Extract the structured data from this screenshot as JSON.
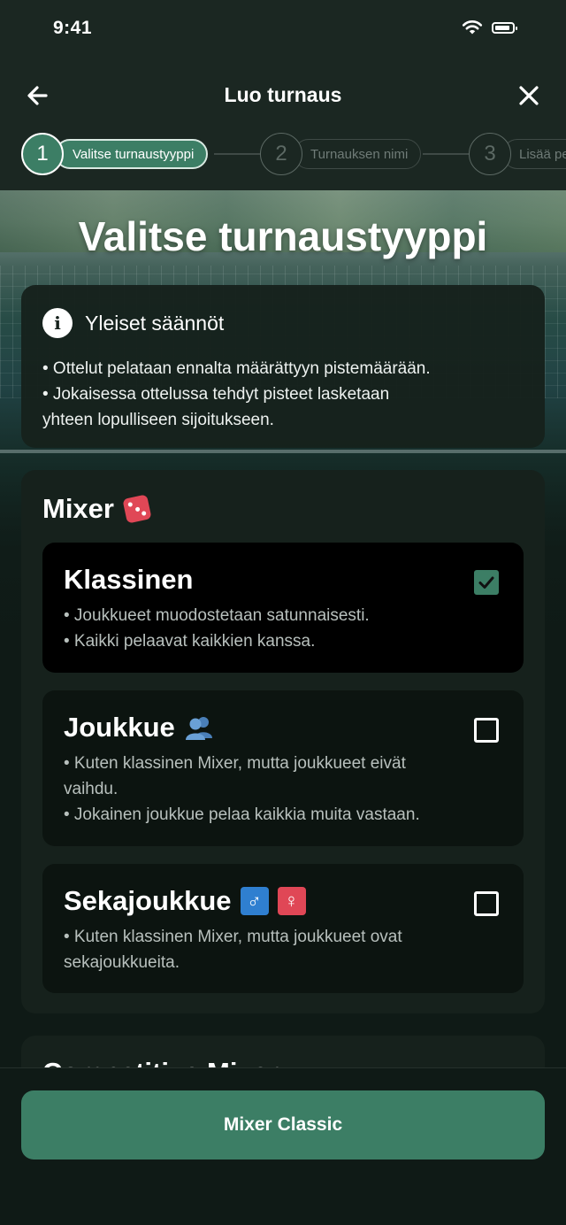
{
  "status_bar": {
    "time": "9:41"
  },
  "nav": {
    "title": "Luo turnaus"
  },
  "stepper": [
    {
      "number": "1",
      "label": "Valitse turnaustyyppi"
    },
    {
      "number": "2",
      "label": "Turnauksen nimi"
    },
    {
      "number": "3",
      "label": "Lisää pe"
    }
  ],
  "page": {
    "title": "Valitse turnaustyyppi"
  },
  "info": {
    "title": "Yleiset säännöt",
    "lines": [
      "• Ottelut pelataan ennalta määrättyyn pistemäärään.",
      "• Jokaisessa ottelussa tehdyt pisteet lasketaan",
      "yhteen lopulliseen sijoitukseen."
    ]
  },
  "mixer": {
    "title": "Mixer",
    "options": [
      {
        "title": "Klassinen",
        "lines": [
          "• Joukkueet muodostetaan satunnaisesti.",
          "• Kaikki pelaavat kaikkien kanssa."
        ],
        "checked": true
      },
      {
        "title": "Joukkue",
        "lines": [
          "• Kuten klassinen Mixer, mutta joukkueet eivät",
          "vaihdu.",
          "• Jokainen joukkue pelaa kaikkia muita vastaan."
        ],
        "checked": false
      },
      {
        "title": "Sekajoukkue",
        "male_symbol": "♂",
        "female_symbol": "♀",
        "lines": [
          "• Kuten klassinen Mixer, mutta joukkueet ovat",
          "sekajoukkueita."
        ],
        "checked": false
      }
    ]
  },
  "next_section": {
    "title": "Competitive Mixer"
  },
  "footer": {
    "button_label": "Mixer Classic"
  },
  "colors": {
    "accent": "#3c7e65",
    "dice": "#e04756",
    "male": "#2f7fd0",
    "female": "#e04756"
  },
  "icons": [
    "back-arrow-icon",
    "close-icon",
    "wifi-icon",
    "battery-icon",
    "info-icon",
    "dice-icon",
    "people-icon",
    "checkbox-icon"
  ]
}
